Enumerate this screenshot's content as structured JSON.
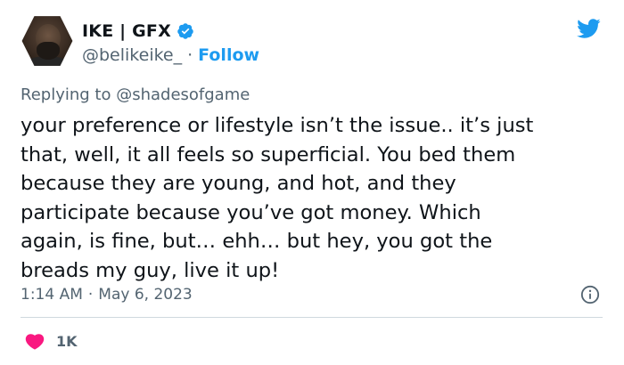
{
  "author": {
    "display_name": "IKE | GFX",
    "handle": "@belikeike_",
    "separator": "·",
    "follow_label": "Follow",
    "verified": true
  },
  "tweet": {
    "reply_to": "Replying to @shadesofgame",
    "text": "your preference or lifestyle isn’t the issue.. it’s just\nthat, well, it all feels so superficial. You bed them\nbecause they are young, and hot, and they\nparticipate because you’ve got money. Which\nagain, is fine, but… ehh… but hey, you got the\nbreads my guy, live it up!",
    "time": "1:14 AM",
    "meta_separator": "·",
    "date": "May 6, 2023"
  },
  "engagement": {
    "likes": "1K"
  },
  "icons": {
    "platform": "twitter-bird-icon",
    "verified": "verified-badge-icon",
    "info": "info-icon",
    "like": "heart-icon"
  },
  "colors": {
    "brand_blue": "#1d9bf0",
    "secondary_text": "#536471",
    "primary_text": "#0f1419",
    "like_red": "#f91880",
    "divider": "#cfd9de"
  }
}
